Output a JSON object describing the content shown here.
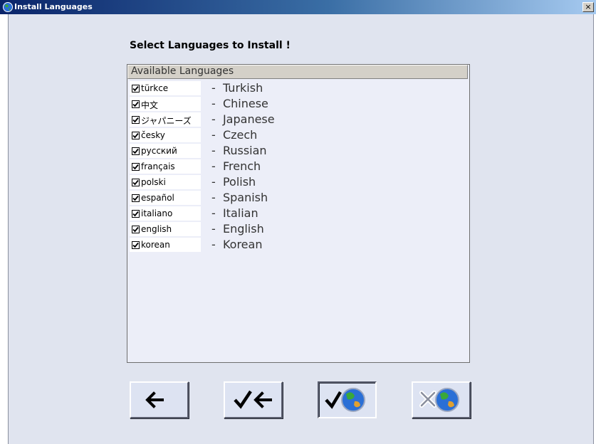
{
  "window": {
    "title": "Install Languages",
    "close_label": "×",
    "app_icon": "globe-icon"
  },
  "main": {
    "heading": "Select Languages to Install !",
    "list_header": "Available Languages",
    "separator": "-",
    "languages": [
      {
        "native": "türkce",
        "english": "Turkish",
        "checked": true
      },
      {
        "native": "中文",
        "english": "Chinese",
        "checked": true
      },
      {
        "native": "ジャパニーズ",
        "english": "Japanese",
        "checked": true
      },
      {
        "native": "česky",
        "english": "Czech",
        "checked": true
      },
      {
        "native": "русский",
        "english": "Russian",
        "checked": true
      },
      {
        "native": "français",
        "english": "French",
        "checked": true
      },
      {
        "native": "polski",
        "english": "Polish",
        "checked": true
      },
      {
        "native": "español",
        "english": "Spanish",
        "checked": true
      },
      {
        "native": "italiano",
        "english": "Italian",
        "checked": true
      },
      {
        "native": "english",
        "english": "English",
        "checked": true
      },
      {
        "native": "korean",
        "english": "Korean",
        "checked": true
      }
    ]
  },
  "buttons": [
    {
      "name": "back-button",
      "icon": "arrow-left-icon"
    },
    {
      "name": "select-all-back-button",
      "icon": "check-arrow-left-icon"
    },
    {
      "name": "install-button",
      "icon": "check-globe-icon"
    },
    {
      "name": "cancel-install-button",
      "icon": "x-globe-icon"
    }
  ]
}
